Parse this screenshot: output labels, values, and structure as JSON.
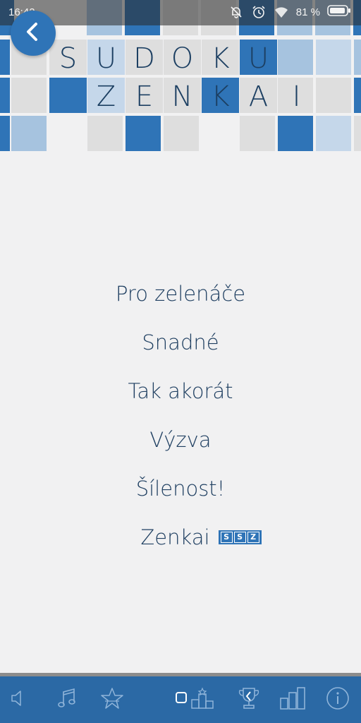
{
  "status_bar": {
    "time": "16:42",
    "battery": "81 %"
  },
  "header": {
    "title_row1": [
      "S",
      "U",
      "D",
      "O",
      "K",
      "U"
    ],
    "title_row2": [
      "Z",
      "E",
      "N",
      "K",
      "A",
      "I"
    ],
    "back_icon": "chevron-left-icon"
  },
  "menu": {
    "items": [
      {
        "label": "Pro zelenáče"
      },
      {
        "label": "Snadné"
      },
      {
        "label": "Tak akorát"
      },
      {
        "label": "Výzva"
      },
      {
        "label": "Šílenost!"
      },
      {
        "label": "Zenkai"
      }
    ],
    "zenkai_badge": [
      "S",
      "S",
      "Z"
    ]
  },
  "bottom_bar": {
    "icons": [
      "speaker-icon",
      "music-note-icon",
      "star-icon",
      "leaderboard-podium-icon",
      "trophy-icon",
      "bar-chart-icon",
      "info-icon"
    ]
  },
  "colors": {
    "accent": "#2f74b7",
    "bottom_bar": "#2b69a5",
    "text": "#1f3f61",
    "background": "#f1f1f2"
  }
}
